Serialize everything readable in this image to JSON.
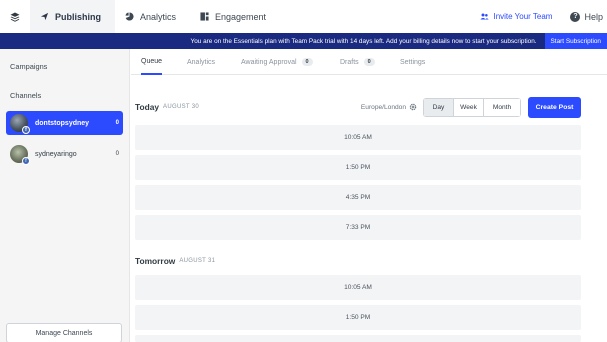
{
  "nav": {
    "tabs": [
      {
        "label": "Publishing",
        "icon": "publish-icon"
      },
      {
        "label": "Analytics",
        "icon": "analytics-icon"
      },
      {
        "label": "Engagement",
        "icon": "engagement-icon"
      }
    ],
    "invite_label": "Invite Your Team",
    "help_label": "Help"
  },
  "banner": {
    "text": "You are on the Essentials plan with Team Pack trial with 14 days left. Add your billing details now to start your subscription.",
    "button": "Start Subscription"
  },
  "sidebar": {
    "campaigns": "Campaigns",
    "channels": "Channels",
    "items": [
      {
        "name": "dontstopsydney",
        "count": "0",
        "active": true
      },
      {
        "name": "sydneyaringo",
        "count": "0",
        "active": false
      }
    ],
    "manage": "Manage Channels"
  },
  "tabs": [
    {
      "label": "Queue"
    },
    {
      "label": "Analytics"
    },
    {
      "label": "Awaiting Approval",
      "count": "0"
    },
    {
      "label": "Drafts",
      "count": "0"
    },
    {
      "label": "Settings"
    }
  ],
  "today": {
    "title": "Today",
    "date": "AUGUST 30",
    "timezone": "Europe/London",
    "views": [
      "Day",
      "Week",
      "Month"
    ],
    "create": "Create Post",
    "slots": [
      "10:05 AM",
      "1:50 PM",
      "4:35 PM",
      "7:33 PM"
    ]
  },
  "tomorrow": {
    "title": "Tomorrow",
    "date": "AUGUST 31",
    "slots": [
      "10:05 AM",
      "1:50 PM"
    ]
  },
  "colors": {
    "accent": "#2c4bff",
    "banner": "#1a2a80",
    "slot_bg": "#f3f4f5"
  }
}
